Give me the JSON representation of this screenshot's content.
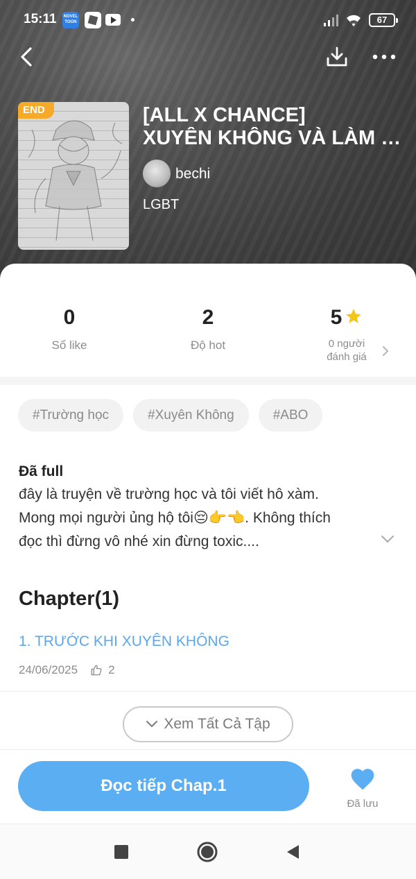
{
  "status_bar": {
    "time": "15:11",
    "app_icon_label": "NOVEL TOON",
    "battery": "67"
  },
  "book": {
    "badge": "END",
    "title_line1": "[ALL X CHANCE]",
    "title_line2": "XUYÊN KHÔNG VÀ LÀM N...",
    "author": "bechi",
    "genre": "LGBT"
  },
  "stats": {
    "likes_value": "0",
    "likes_label": "Số like",
    "hot_value": "2",
    "hot_label": "Độ hot",
    "rating_value": "5",
    "rating_sub_line1": "0 người",
    "rating_sub_line2": "đánh giá"
  },
  "tags": [
    "#Trường học",
    "#Xuyên Không",
    "#ABO"
  ],
  "description": {
    "heading": "Đã full",
    "line1": "đây là truyện về trường học và tôi viết hô xàm.",
    "line2": "Mong mọi người ủng hộ tôi😔👉👈. Không thích",
    "line3": "đọc thì đừng vô nhé xin đừng toxic...."
  },
  "chapters": {
    "header": "Chapter(1)",
    "items": [
      {
        "title": "1. TRƯỚC KHI XUYÊN KHÔNG",
        "date": "24/06/2025",
        "likes": "2"
      }
    ],
    "view_all_label": "Xem Tất Cả Tập"
  },
  "actions": {
    "read_label": "Đọc tiếp Chap.1",
    "saved_label": "Đã lưu"
  },
  "colors": {
    "accent": "#5caef3",
    "badge": "#f7a928",
    "star": "#f5c518",
    "chapter_link": "#5aa7f0"
  }
}
